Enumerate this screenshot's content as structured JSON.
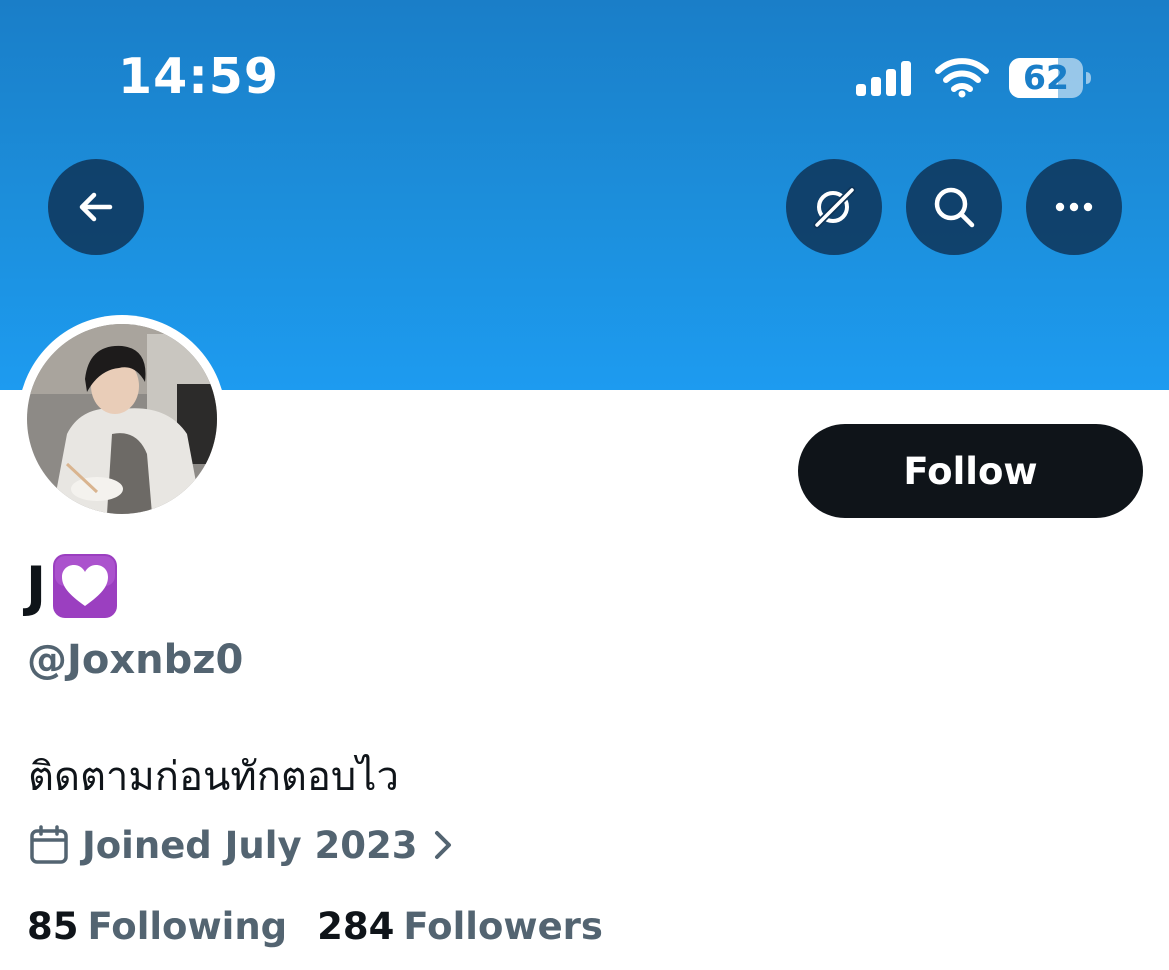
{
  "status_bar": {
    "time": "14:59",
    "battery": "62"
  },
  "nav": {
    "back_icon": "arrow-left-icon",
    "grok_icon": "grok-icon",
    "search_icon": "search-icon",
    "more_icon": "more-horizontal-icon"
  },
  "colors": {
    "banner": "#1d9bf0",
    "follow_button": "#0f1419",
    "secondary_text": "#536471"
  },
  "profile": {
    "display_name": "J",
    "display_name_emoji": "💟",
    "handle": "@Joxnbz0",
    "follow_label": "Follow",
    "bio": "ติดตามก่อนทักตอบไว",
    "joined": "Joined July 2023",
    "following_count": "85",
    "following_label": "Following",
    "followers_count": "284",
    "followers_label": "Followers"
  }
}
